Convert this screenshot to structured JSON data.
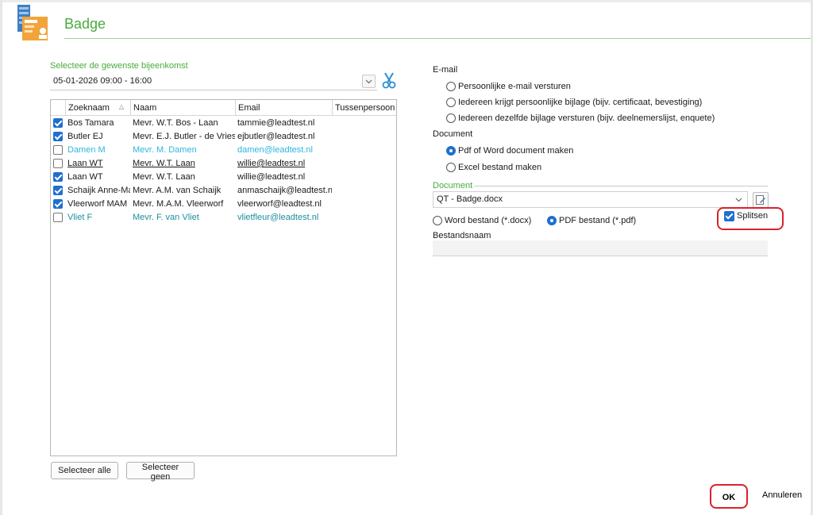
{
  "window": {
    "title": "Badge"
  },
  "event": {
    "label": "Selecteer de gewenste bijeenkomst",
    "value": "05-01-2026  09:00 - 16:00"
  },
  "grid": {
    "columns": [
      "Zoeknaam",
      "Naam",
      "Email",
      "Tussenpersoon"
    ],
    "rows": [
      {
        "checked": true,
        "style": "normal",
        "zoeknaam": "Bos Tamara",
        "naam": "Mevr. W.T. Bos - Laan",
        "email": "tammie@leadtest.nl",
        "tussenpersoon": ""
      },
      {
        "checked": true,
        "style": "normal",
        "zoeknaam": "Butler EJ",
        "naam": "Mevr. E.J. Butler - de Vries",
        "email": "ejbutler@leadtest.nl",
        "tussenpersoon": ""
      },
      {
        "checked": false,
        "style": "cyan",
        "zoeknaam": "Damen M",
        "naam": "Mevr. M. Damen",
        "email": "damen@leadtest.nl",
        "tussenpersoon": ""
      },
      {
        "checked": false,
        "style": "ul",
        "zoeknaam": "Laan WT",
        "naam": "Mevr. W.T. Laan",
        "email": "willie@leadtest.nl",
        "tussenpersoon": ""
      },
      {
        "checked": true,
        "style": "normal",
        "zoeknaam": "Laan WT",
        "naam": "Mevr. W.T. Laan",
        "email": "willie@leadtest.nl",
        "tussenpersoon": ""
      },
      {
        "checked": true,
        "style": "normal",
        "zoeknaam": "Schaijk Anne-Marie",
        "naam": "Mevr. A.M. van Schaijk",
        "email": "anmaschaijk@leadtest.nl",
        "tussenpersoon": ""
      },
      {
        "checked": true,
        "style": "normal",
        "zoeknaam": "Vleerworf MAM",
        "naam": "Mevr. M.A.M. Vleerworf",
        "email": "vleerworf@leadtest.nl",
        "tussenpersoon": ""
      },
      {
        "checked": false,
        "style": "teal",
        "zoeknaam": "Vliet F",
        "naam": "Mevr. F. van Vliet",
        "email": "vlietfleur@leadtest.nl",
        "tussenpersoon": ""
      }
    ],
    "select_all": "Selecteer alle",
    "select_none": "Selecteer geen"
  },
  "email_section": {
    "label": "E-mail",
    "options": [
      "Persoonlijke e-mail versturen",
      "Iedereen krijgt persoonlijke bijlage (bijv. certificaat, bevestiging)",
      "Iedereen dezelfde bijlage versturen (bijv. deelnemerslijst, enquete)"
    ]
  },
  "document_section": {
    "label": "Document",
    "options": [
      "Pdf of Word document maken",
      "Excel bestand maken"
    ],
    "selected": 0
  },
  "document_picker": {
    "label": "Document",
    "value": "QT - Badge.docx",
    "format_options": [
      "Word bestand (*.docx)",
      "PDF bestand (*.pdf)"
    ],
    "format_selected": 1,
    "split_label": "Splitsen",
    "split_checked": true,
    "filename_label": "Bestandsnaam",
    "filename_value": ""
  },
  "footer": {
    "ok": "OK",
    "cancel": "Annuleren"
  },
  "colors": {
    "accent_green": "#4aaa3e",
    "check_blue": "#1e6fcf",
    "highlight_red": "#d9222b"
  }
}
